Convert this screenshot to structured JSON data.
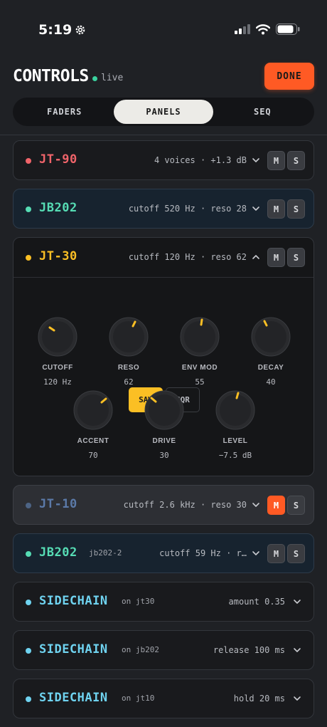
{
  "status_bar": {
    "time": "5:19"
  },
  "header": {
    "title": "CONTROLS",
    "live_label": "live",
    "done_label": "DONE"
  },
  "tabs": [
    {
      "label": "FADERS",
      "active": false
    },
    {
      "label": "PANELS",
      "active": true
    },
    {
      "label": "SEQ",
      "active": false
    }
  ],
  "tracks": {
    "jt90": {
      "name": "JT-90",
      "info": "4 voices · +1.3 dB",
      "m": "M",
      "s": "S"
    },
    "jb202": {
      "name": "JB202",
      "info": "cutoff 520 Hz · reso 28",
      "m": "M",
      "s": "S"
    },
    "jt30": {
      "name": "JT-30",
      "info": "cutoff 120 Hz · reso 62",
      "m": "M",
      "s": "S",
      "waves": [
        "SAW",
        "SQR"
      ],
      "wave_selected": "SAW",
      "knobs": [
        {
          "label": "CUTOFF",
          "value": "120 Hz"
        },
        {
          "label": "RESO",
          "value": "62"
        },
        {
          "label": "ENV MOD",
          "value": "55"
        },
        {
          "label": "DECAY",
          "value": "40"
        },
        {
          "label": "ACCENT",
          "value": "70"
        },
        {
          "label": "DRIVE",
          "value": "30"
        },
        {
          "label": "LEVEL",
          "value": "−7.5 dB"
        }
      ]
    },
    "jt10": {
      "name": "JT-10",
      "info": "cutoff 2.6 kHz · reso 30",
      "m": "M",
      "s": "S",
      "muted": true
    },
    "jb202_2": {
      "name": "JB202",
      "sub": "jb202-2",
      "info": "cutoff 59 Hz · r…",
      "m": "M",
      "s": "S"
    },
    "sidechain1": {
      "name": "SIDECHAIN",
      "sub": "on jt30",
      "info": "amount 0.35"
    },
    "sidechain2": {
      "name": "SIDECHAIN",
      "sub": "on jb202",
      "info": "release 100 ms"
    },
    "sidechain3": {
      "name": "SIDECHAIN",
      "sub": "on jt10",
      "info": "hold 20 ms"
    }
  },
  "colors": {
    "accent": "#ff5a24",
    "jt90": "#f0646a",
    "jb202": "#56dcb4",
    "jt30": "#fbbf24",
    "jt10": "#5b7aa8",
    "sidechain": "#6fd3f0"
  }
}
